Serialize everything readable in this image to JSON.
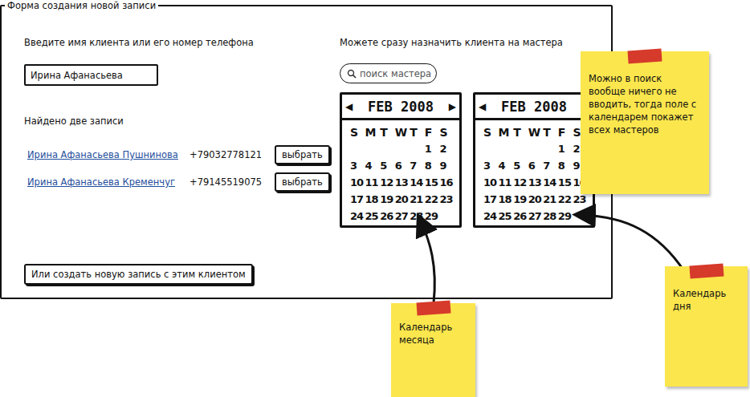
{
  "form": {
    "title": "Форма создания новой записи"
  },
  "client": {
    "label": "Введите имя клиента или его номер телефона",
    "value": "Ирина Афанасьева",
    "found": "Найдено две записи",
    "results": [
      {
        "name": "Ирина Афанасьева Пушнинова",
        "phone": "+79032778121",
        "button": "выбрать"
      },
      {
        "name": "Ирина Афанасьева Кременчуг",
        "phone": "+79145519075",
        "button": "выбрать"
      }
    ],
    "create_button": "Или создать новую запись с этим клиентом"
  },
  "master": {
    "label": "Можете сразу назначить клиента на мастера",
    "search": {
      "placeholder": "поиск мастера"
    },
    "calendars": [
      {
        "prev": "◀",
        "month": "FEB 2008",
        "next": "▶",
        "weekdays": [
          "S",
          "M",
          "T",
          "W",
          "T",
          "F",
          "S"
        ],
        "weeks": [
          [
            "",
            "",
            "",
            "",
            "",
            "1",
            "2"
          ],
          [
            "3",
            "4",
            "5",
            "6",
            "7",
            "8",
            "9"
          ],
          [
            "10",
            "11",
            "12",
            "13",
            "14",
            "15",
            "16"
          ],
          [
            "17",
            "18",
            "19",
            "20",
            "21",
            "22",
            "23"
          ],
          [
            "24",
            "25",
            "26",
            "27",
            "28",
            "29",
            ""
          ]
        ]
      },
      {
        "prev": "◀",
        "month": "FEB 2008",
        "next": "▶",
        "weekdays": [
          "S",
          "M",
          "T",
          "W",
          "T",
          "F",
          "S"
        ],
        "weeks": [
          [
            "",
            "",
            "",
            "",
            "",
            "1",
            "2"
          ],
          [
            "3",
            "4",
            "5",
            "6",
            "7",
            "8",
            "9"
          ],
          [
            "10",
            "11",
            "12",
            "13",
            "14",
            "15",
            "16"
          ],
          [
            "17",
            "18",
            "19",
            "20",
            "21",
            "22",
            "23"
          ],
          [
            "24",
            "25",
            "26",
            "27",
            "28",
            "29",
            ""
          ]
        ]
      }
    ]
  },
  "notes": [
    {
      "text": "Можно в поиск вообще ничего не вводить, тогда поле с календарем покажет всех мастеров"
    },
    {
      "text": "Календарь месяца"
    },
    {
      "text": "Календарь дня"
    }
  ]
}
